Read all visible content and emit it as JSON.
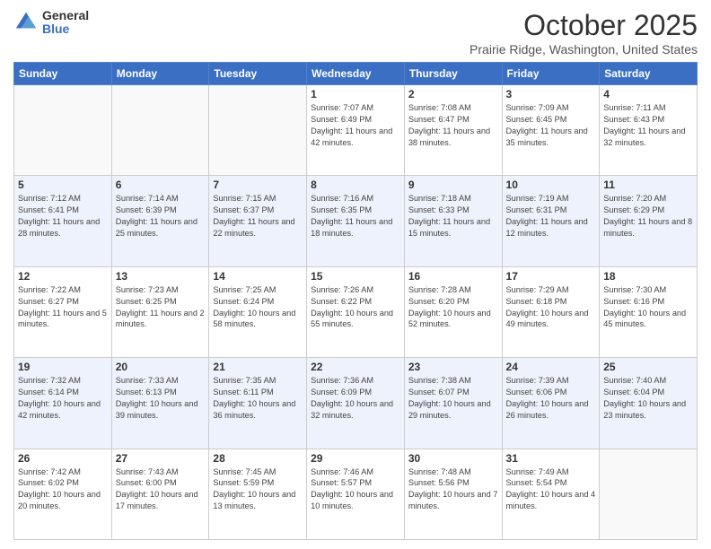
{
  "header": {
    "logo_general": "General",
    "logo_blue": "Blue",
    "month_title": "October 2025",
    "location": "Prairie Ridge, Washington, United States"
  },
  "days_of_week": [
    "Sunday",
    "Monday",
    "Tuesday",
    "Wednesday",
    "Thursday",
    "Friday",
    "Saturday"
  ],
  "weeks": [
    [
      {
        "day": "",
        "sunrise": "",
        "sunset": "",
        "daylight": ""
      },
      {
        "day": "",
        "sunrise": "",
        "sunset": "",
        "daylight": ""
      },
      {
        "day": "",
        "sunrise": "",
        "sunset": "",
        "daylight": ""
      },
      {
        "day": "1",
        "sunrise": "7:07 AM",
        "sunset": "6:49 PM",
        "daylight": "11 hours and 42 minutes."
      },
      {
        "day": "2",
        "sunrise": "7:08 AM",
        "sunset": "6:47 PM",
        "daylight": "11 hours and 38 minutes."
      },
      {
        "day": "3",
        "sunrise": "7:09 AM",
        "sunset": "6:45 PM",
        "daylight": "11 hours and 35 minutes."
      },
      {
        "day": "4",
        "sunrise": "7:11 AM",
        "sunset": "6:43 PM",
        "daylight": "11 hours and 32 minutes."
      }
    ],
    [
      {
        "day": "5",
        "sunrise": "7:12 AM",
        "sunset": "6:41 PM",
        "daylight": "11 hours and 28 minutes."
      },
      {
        "day": "6",
        "sunrise": "7:14 AM",
        "sunset": "6:39 PM",
        "daylight": "11 hours and 25 minutes."
      },
      {
        "day": "7",
        "sunrise": "7:15 AM",
        "sunset": "6:37 PM",
        "daylight": "11 hours and 22 minutes."
      },
      {
        "day": "8",
        "sunrise": "7:16 AM",
        "sunset": "6:35 PM",
        "daylight": "11 hours and 18 minutes."
      },
      {
        "day": "9",
        "sunrise": "7:18 AM",
        "sunset": "6:33 PM",
        "daylight": "11 hours and 15 minutes."
      },
      {
        "day": "10",
        "sunrise": "7:19 AM",
        "sunset": "6:31 PM",
        "daylight": "11 hours and 12 minutes."
      },
      {
        "day": "11",
        "sunrise": "7:20 AM",
        "sunset": "6:29 PM",
        "daylight": "11 hours and 8 minutes."
      }
    ],
    [
      {
        "day": "12",
        "sunrise": "7:22 AM",
        "sunset": "6:27 PM",
        "daylight": "11 hours and 5 minutes."
      },
      {
        "day": "13",
        "sunrise": "7:23 AM",
        "sunset": "6:25 PM",
        "daylight": "11 hours and 2 minutes."
      },
      {
        "day": "14",
        "sunrise": "7:25 AM",
        "sunset": "6:24 PM",
        "daylight": "10 hours and 58 minutes."
      },
      {
        "day": "15",
        "sunrise": "7:26 AM",
        "sunset": "6:22 PM",
        "daylight": "10 hours and 55 minutes."
      },
      {
        "day": "16",
        "sunrise": "7:28 AM",
        "sunset": "6:20 PM",
        "daylight": "10 hours and 52 minutes."
      },
      {
        "day": "17",
        "sunrise": "7:29 AM",
        "sunset": "6:18 PM",
        "daylight": "10 hours and 49 minutes."
      },
      {
        "day": "18",
        "sunrise": "7:30 AM",
        "sunset": "6:16 PM",
        "daylight": "10 hours and 45 minutes."
      }
    ],
    [
      {
        "day": "19",
        "sunrise": "7:32 AM",
        "sunset": "6:14 PM",
        "daylight": "10 hours and 42 minutes."
      },
      {
        "day": "20",
        "sunrise": "7:33 AM",
        "sunset": "6:13 PM",
        "daylight": "10 hours and 39 minutes."
      },
      {
        "day": "21",
        "sunrise": "7:35 AM",
        "sunset": "6:11 PM",
        "daylight": "10 hours and 36 minutes."
      },
      {
        "day": "22",
        "sunrise": "7:36 AM",
        "sunset": "6:09 PM",
        "daylight": "10 hours and 32 minutes."
      },
      {
        "day": "23",
        "sunrise": "7:38 AM",
        "sunset": "6:07 PM",
        "daylight": "10 hours and 29 minutes."
      },
      {
        "day": "24",
        "sunrise": "7:39 AM",
        "sunset": "6:06 PM",
        "daylight": "10 hours and 26 minutes."
      },
      {
        "day": "25",
        "sunrise": "7:40 AM",
        "sunset": "6:04 PM",
        "daylight": "10 hours and 23 minutes."
      }
    ],
    [
      {
        "day": "26",
        "sunrise": "7:42 AM",
        "sunset": "6:02 PM",
        "daylight": "10 hours and 20 minutes."
      },
      {
        "day": "27",
        "sunrise": "7:43 AM",
        "sunset": "6:00 PM",
        "daylight": "10 hours and 17 minutes."
      },
      {
        "day": "28",
        "sunrise": "7:45 AM",
        "sunset": "5:59 PM",
        "daylight": "10 hours and 13 minutes."
      },
      {
        "day": "29",
        "sunrise": "7:46 AM",
        "sunset": "5:57 PM",
        "daylight": "10 hours and 10 minutes."
      },
      {
        "day": "30",
        "sunrise": "7:48 AM",
        "sunset": "5:56 PM",
        "daylight": "10 hours and 7 minutes."
      },
      {
        "day": "31",
        "sunrise": "7:49 AM",
        "sunset": "5:54 PM",
        "daylight": "10 hours and 4 minutes."
      },
      {
        "day": "",
        "sunrise": "",
        "sunset": "",
        "daylight": ""
      }
    ]
  ]
}
